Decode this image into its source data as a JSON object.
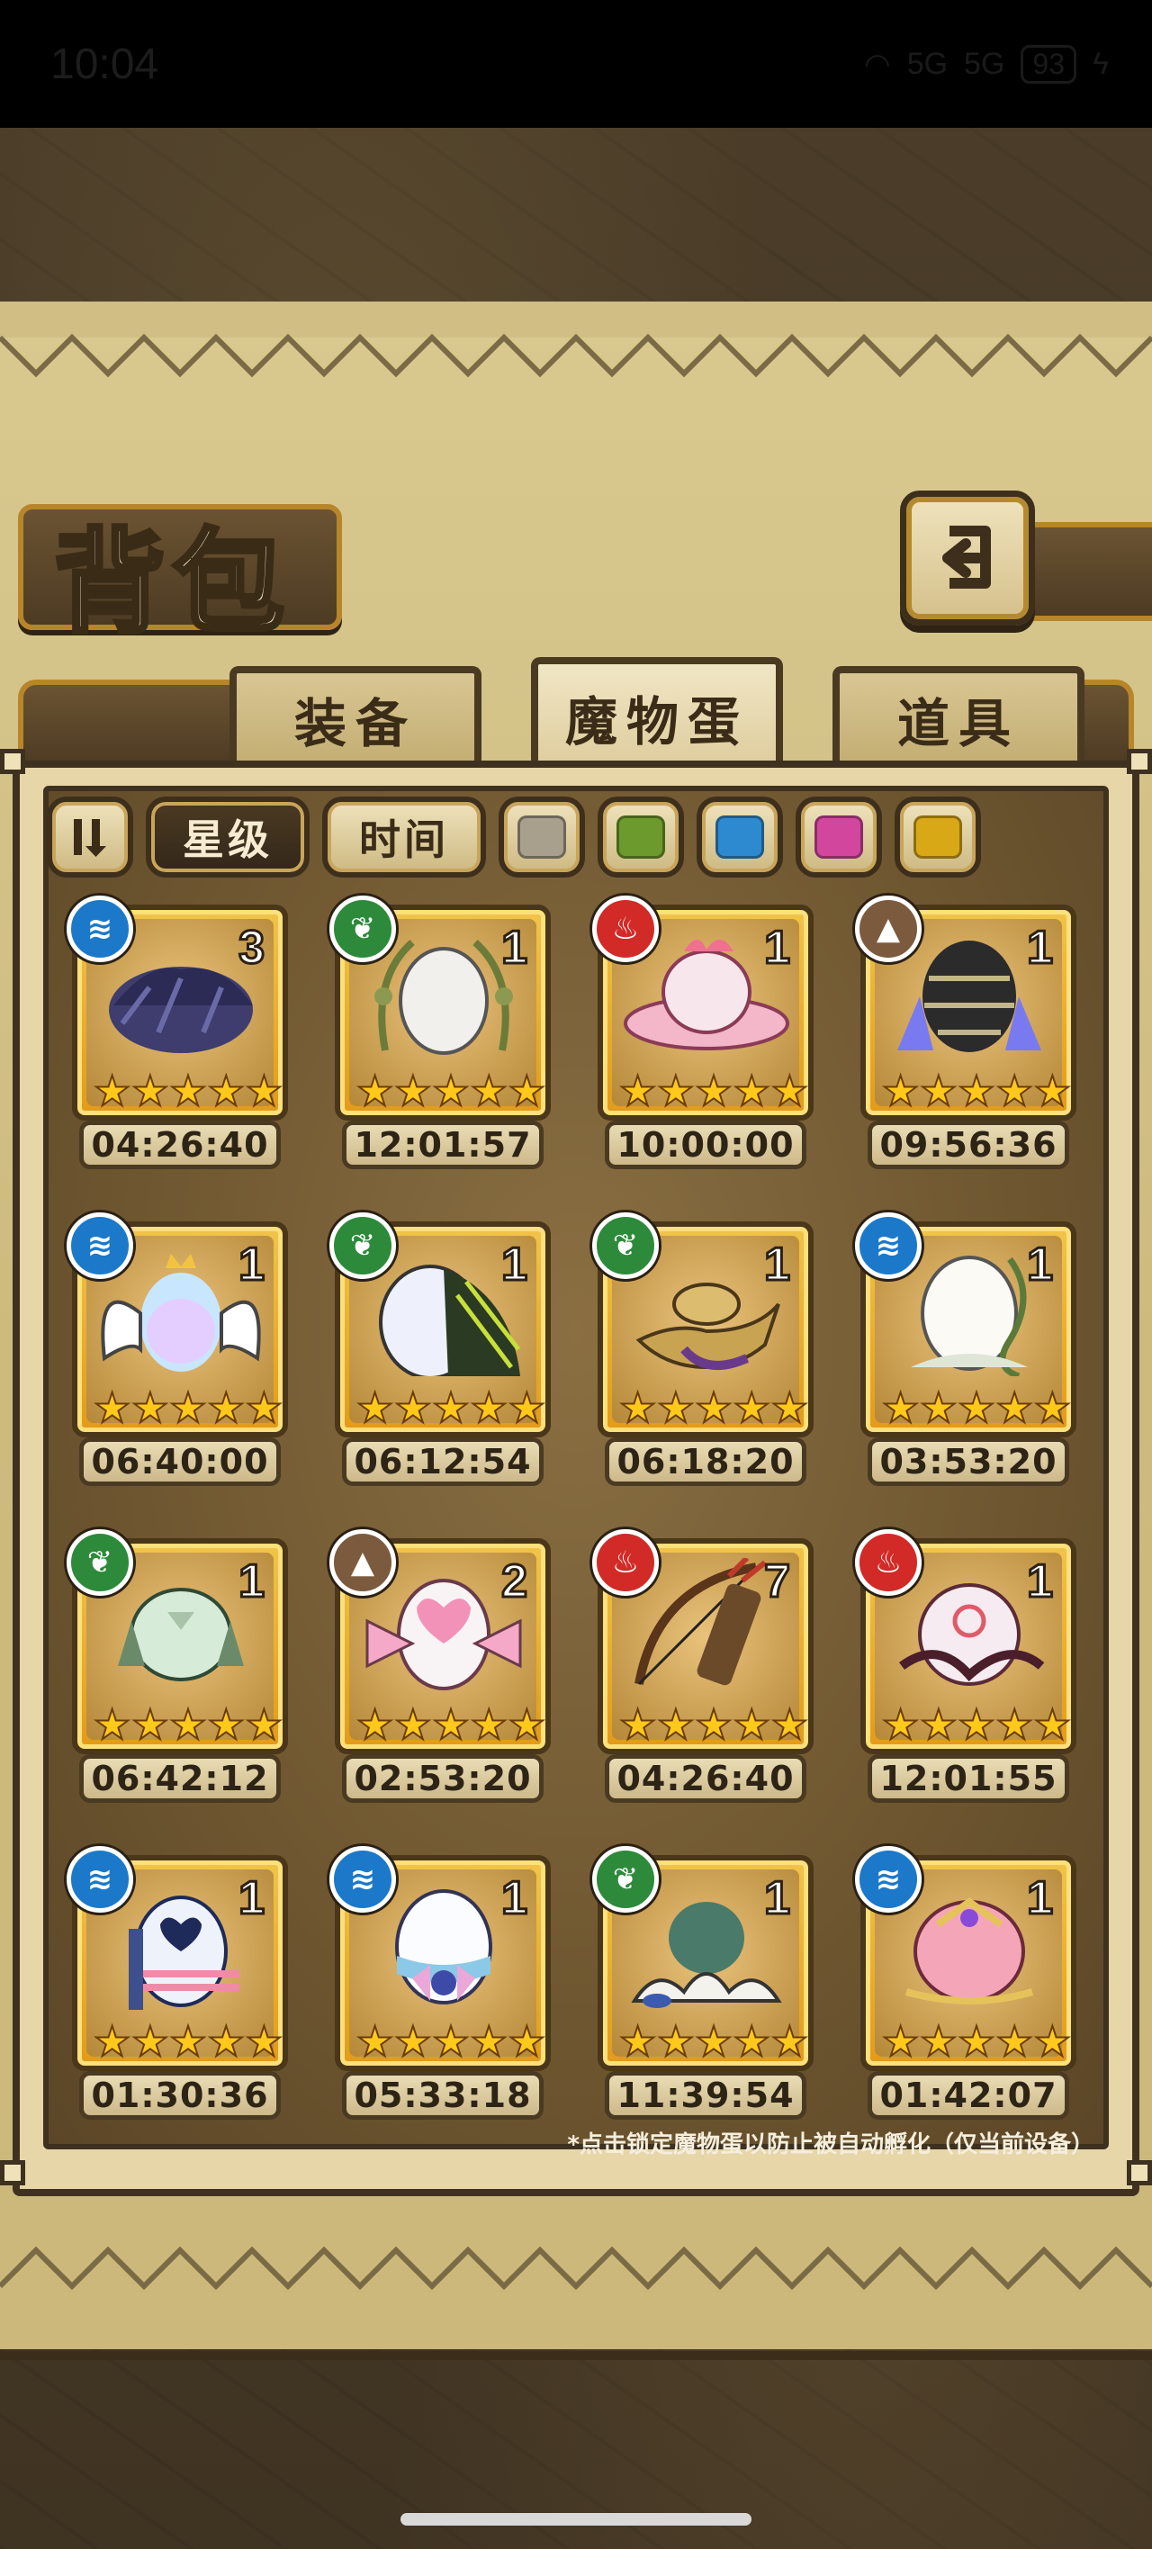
{
  "status_bar": {
    "time": "10:04",
    "signal_1": "5G",
    "signal_2": "5G",
    "battery": "93"
  },
  "header": {
    "title": "背包",
    "back_icon": "back-arrow-icon"
  },
  "tabs": [
    {
      "label": "装备",
      "active": false
    },
    {
      "label": "魔物蛋",
      "active": true
    },
    {
      "label": "道具",
      "active": false
    }
  ],
  "filters": {
    "sort_icon": "sort-icon",
    "star_label": "星级",
    "time_label": "时间",
    "colors": [
      "#a89f8c",
      "#6d9a2c",
      "#2e8ad0",
      "#d2469e",
      "#d9a816"
    ]
  },
  "element_colors": {
    "water": "#1c79c9",
    "grass": "#2d8a3a",
    "fire": "#d22a26",
    "earth": "#7b5a3e"
  },
  "eggs": [
    {
      "element": "water",
      "count": "3",
      "stars": 5,
      "timer": "04:26:40",
      "art": "dark-feather-egg"
    },
    {
      "element": "grass",
      "count": "1",
      "stars": 5,
      "timer": "12:01:57",
      "art": "olive-wreath-egg"
    },
    {
      "element": "fire",
      "count": "1",
      "stars": 5,
      "timer": "10:00:00",
      "art": "cake-egg"
    },
    {
      "element": "earth",
      "count": "1",
      "stars": 5,
      "timer": "09:56:36",
      "art": "crystal-rock-egg"
    },
    {
      "element": "water",
      "count": "1",
      "stars": 5,
      "timer": "06:40:00",
      "art": "winged-crown-egg"
    },
    {
      "element": "grass",
      "count": "1",
      "stars": 5,
      "timer": "06:12:54",
      "art": "wing-egg"
    },
    {
      "element": "grass",
      "count": "1",
      "stars": 5,
      "timer": "06:18:20",
      "art": "magic-lamp-egg"
    },
    {
      "element": "water",
      "count": "1",
      "stars": 5,
      "timer": "03:53:20",
      "art": "vine-egg"
    },
    {
      "element": "grass",
      "count": "1",
      "stars": 5,
      "timer": "06:42:12",
      "art": "mossy-egg"
    },
    {
      "element": "earth",
      "count": "2",
      "stars": 5,
      "timer": "02:53:20",
      "art": "heart-bow-egg"
    },
    {
      "element": "fire",
      "count": "7",
      "stars": 5,
      "timer": "04:26:40",
      "art": "bow-quiver-egg"
    },
    {
      "element": "fire",
      "count": "1",
      "stars": 5,
      "timer": "12:01:55",
      "art": "thorn-egg"
    },
    {
      "element": "water",
      "count": "1",
      "stars": 5,
      "timer": "01:30:36",
      "art": "striped-heart-egg"
    },
    {
      "element": "water",
      "count": "1",
      "stars": 5,
      "timer": "05:33:18",
      "art": "ribbon-egg"
    },
    {
      "element": "grass",
      "count": "1",
      "stars": 5,
      "timer": "11:39:54",
      "art": "leaf-nest-egg"
    },
    {
      "element": "water",
      "count": "1",
      "stars": 5,
      "timer": "01:42:07",
      "art": "jewel-egg"
    }
  ],
  "footnote": "*点击锁定魔物蛋以防止被自动孵化（仅当前设备）"
}
